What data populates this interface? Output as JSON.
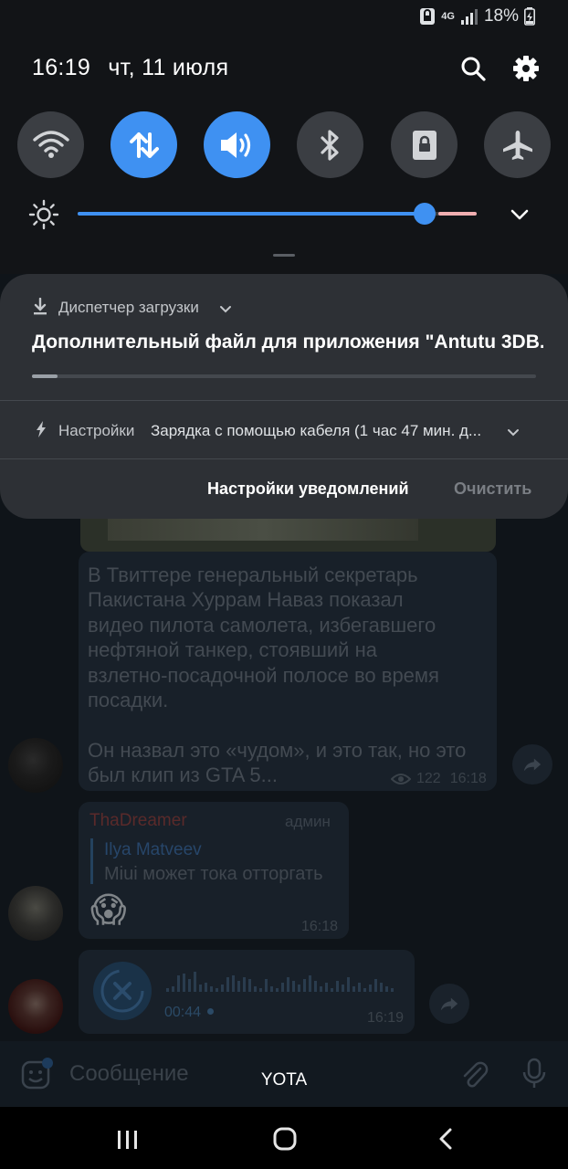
{
  "status": {
    "network": "4G",
    "battery": "18%"
  },
  "header": {
    "time": "16:19",
    "date": "чт, 11 июля"
  },
  "quick_settings": [
    {
      "name": "wifi",
      "on": false
    },
    {
      "name": "mobile-data",
      "on": true
    },
    {
      "name": "sound",
      "on": true
    },
    {
      "name": "bluetooth",
      "on": false
    },
    {
      "name": "rotation-lock",
      "on": false
    },
    {
      "name": "airplane-mode",
      "on": false
    }
  ],
  "brightness": {
    "level": 0.87
  },
  "notifications": {
    "download": {
      "app": "Диспетчер загрузки",
      "title": "Дополнительный файл для приложения \"Antutu 3DB..",
      "progress": 0.05
    },
    "settings": {
      "app": "Настройки",
      "text": "Зарядка с помощью кабеля (1 час 47 мин. д..."
    },
    "actions": {
      "settings": "Настройки уведомлений",
      "clear": "Очистить"
    }
  },
  "chat": {
    "message1": {
      "text": "В Твиттере генеральный секретарь\nПакистана Хуррам Наваз показал\nвидео пилота самолета, избегавшего\nнефтяной танкер, стоявший на\nвзлетно-посадочной полосе во время\nпосадки.\n\nОн назвал это «чудом», и это так, но это\nбыл клип из GTA 5...",
      "views": "122",
      "time": "16:18"
    },
    "message2": {
      "author": "ThaDreamer",
      "role": "админ",
      "reply_author": "Ilya Matveev",
      "reply_text": "Miui может тока отторгать",
      "emoji": "😱",
      "time": "16:18"
    },
    "voice": {
      "duration": "00:44",
      "time": "16:19"
    },
    "input_placeholder": "Сообщение"
  },
  "carrier": "YOTA",
  "colors": {
    "accent": "#3f91f2",
    "card": "#2d3035",
    "shade": "#121417"
  }
}
